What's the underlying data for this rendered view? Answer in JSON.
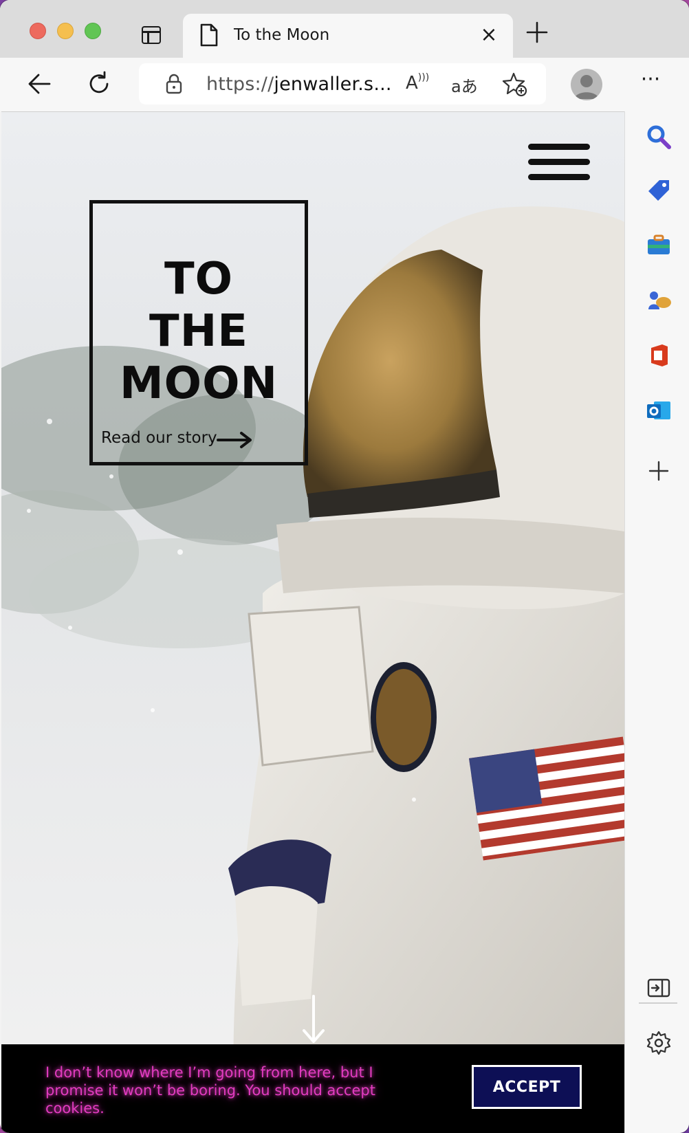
{
  "tab": {
    "title": "To the Moon",
    "close_glyph": "×"
  },
  "address_bar": {
    "scheme": "https://",
    "host": "jenwaller.s..."
  },
  "toolbar": {
    "read_aloud_glyph": "A",
    "translate_glyph": "aあ",
    "more_glyph": "···"
  },
  "hero": {
    "title_lines": [
      "TO",
      "THE",
      "MOON"
    ],
    "cta_label": "Read our story"
  },
  "cookie_banner": {
    "message": "I don’t know where I’m going from here, but I promise it won’t be boring. You should accept cookies.",
    "accept_label": "ACCEPT"
  },
  "colors": {
    "cookie_text": "#e23cc0",
    "accept_bg": "#0d0f55",
    "banner_bg": "#000000"
  },
  "sidebar": {
    "items": [
      "search-icon",
      "shopping-tag-icon",
      "tools-briefcase-icon",
      "games-icon",
      "office-icon",
      "outlook-icon",
      "add-icon",
      "split-screen-icon",
      "settings-gear-icon"
    ]
  }
}
